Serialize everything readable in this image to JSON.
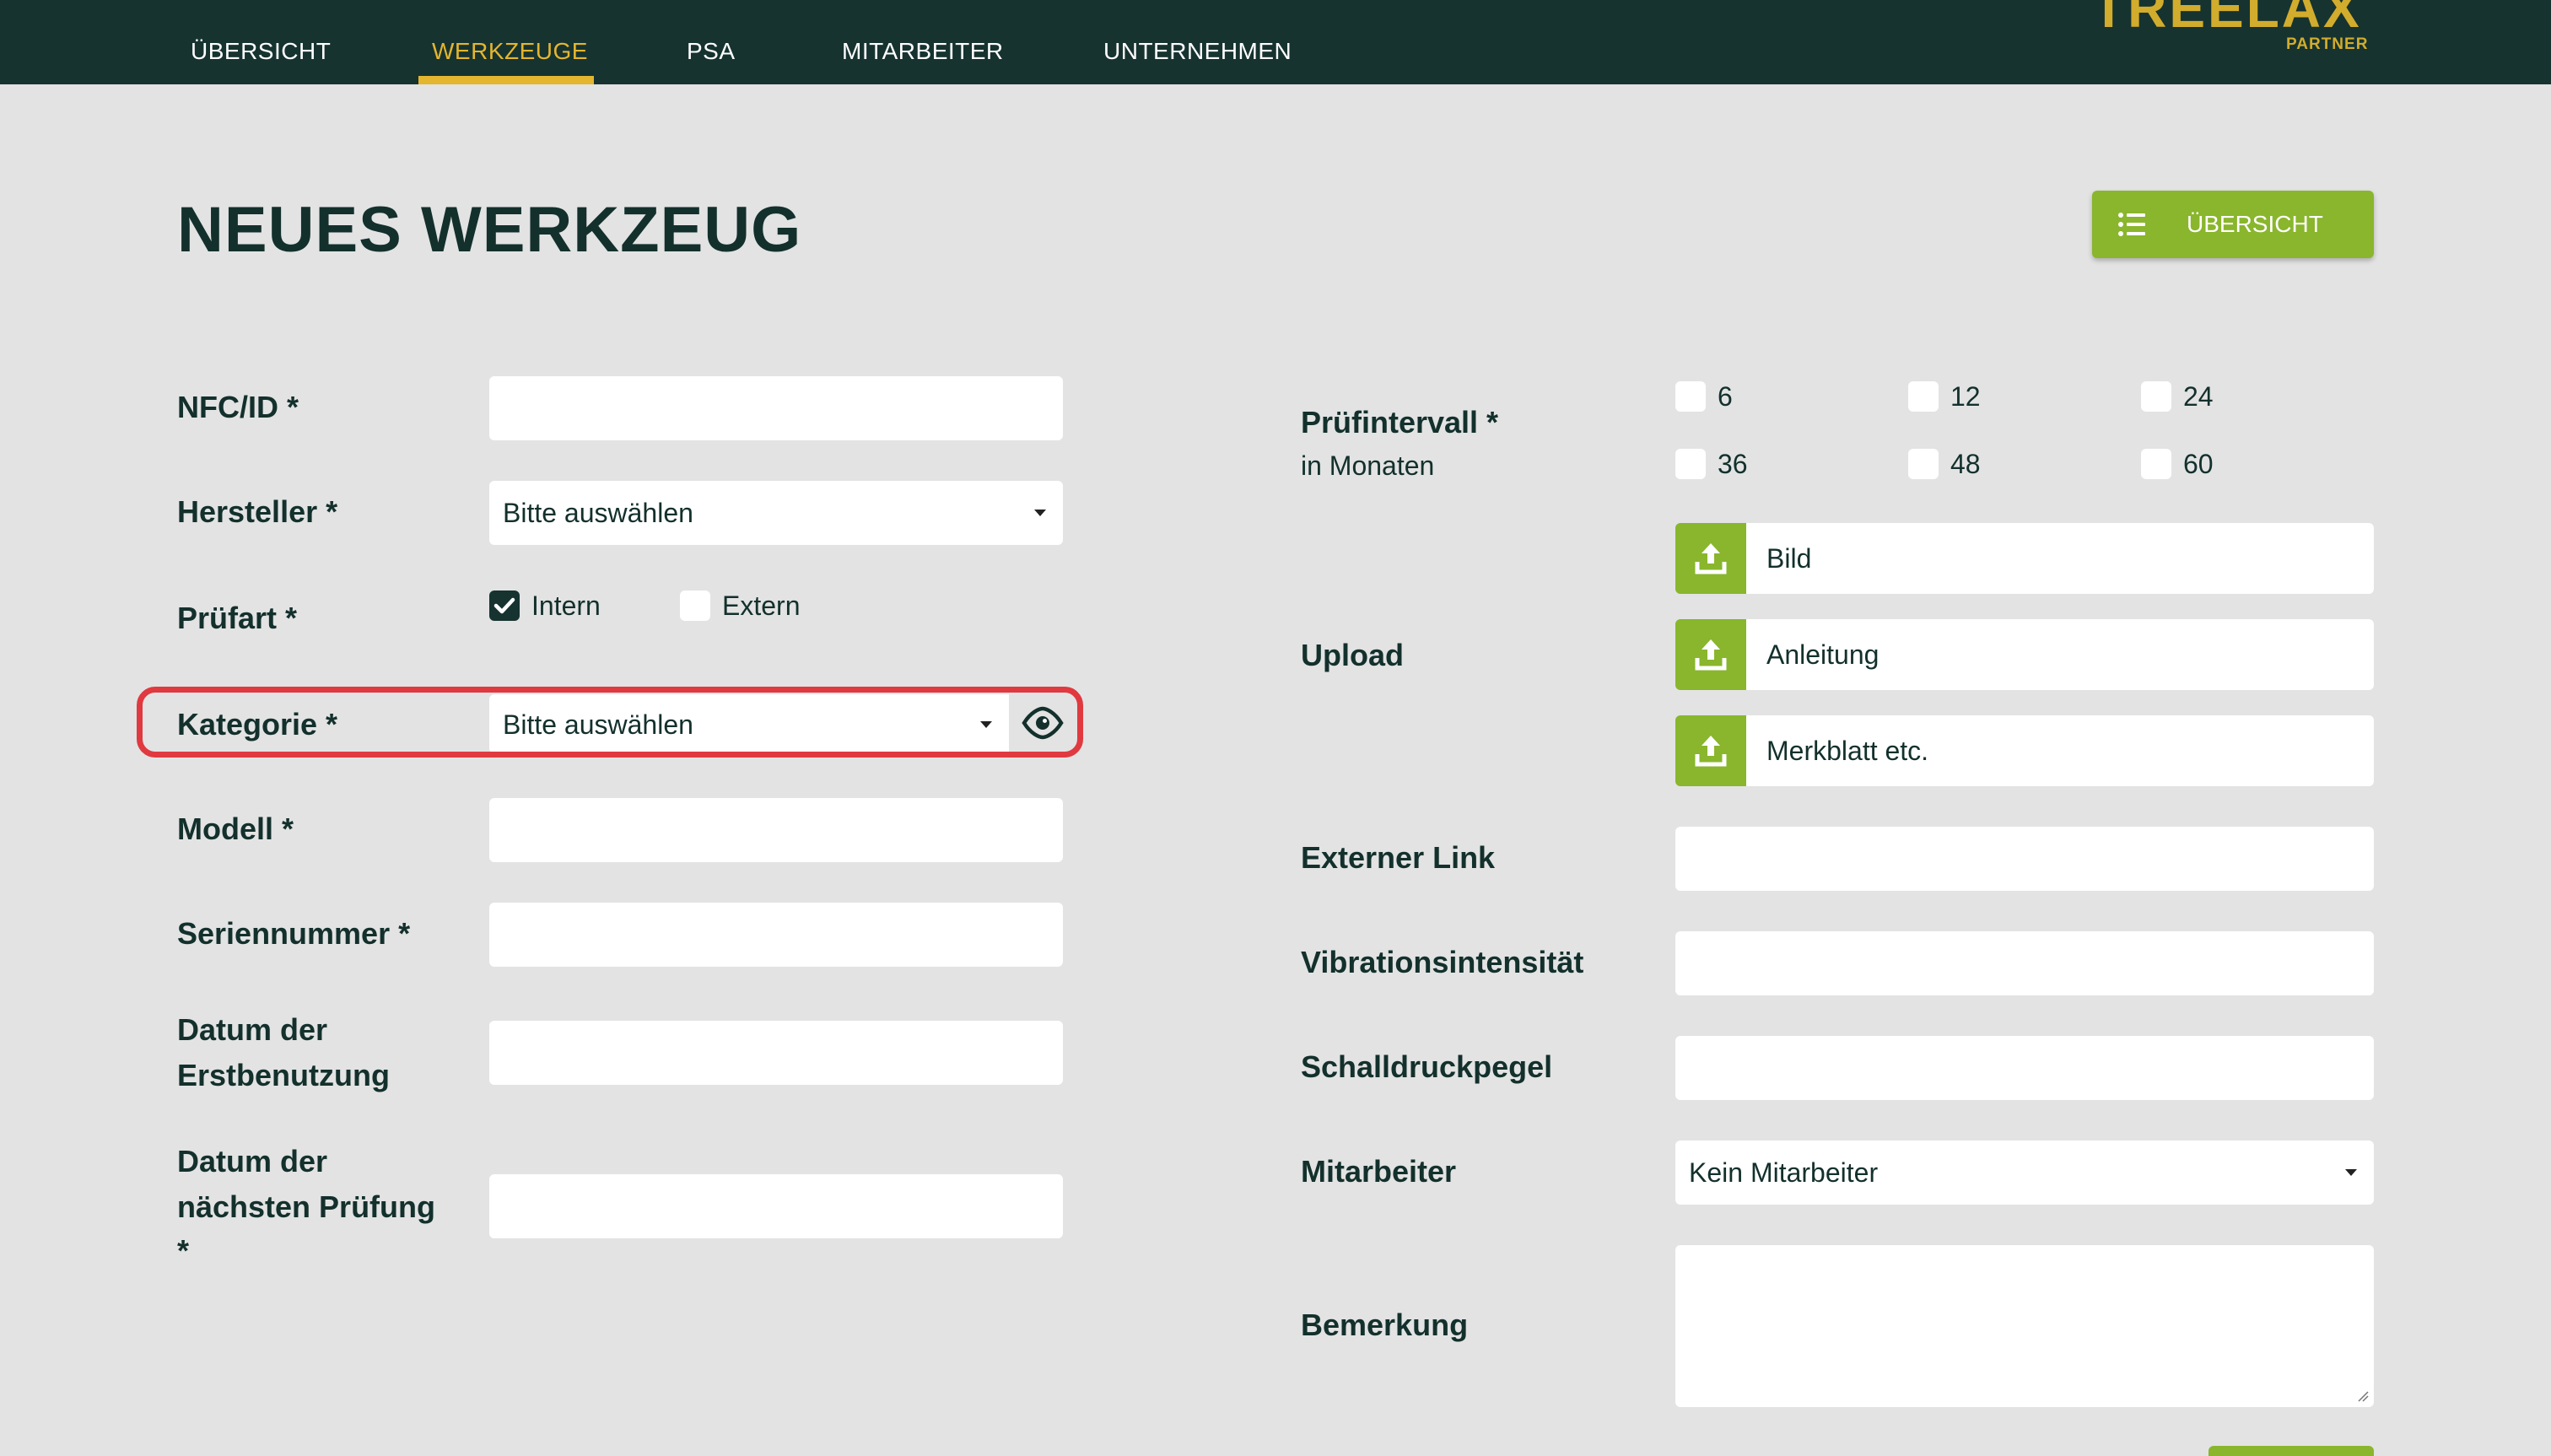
{
  "nav": {
    "items": [
      {
        "label": "ÜBERSICHT"
      },
      {
        "label": "WERKZEUGE"
      },
      {
        "label": "PSA"
      },
      {
        "label": "MITARBEITER"
      },
      {
        "label": "UNTERNEHMEN"
      }
    ],
    "active": "WERKZEUGE"
  },
  "logo": {
    "text": "TREELAX",
    "sub": "PARTNER"
  },
  "page": {
    "title": "NEUES WERKZEUG",
    "overview_button": "ÜBERSICHT"
  },
  "form_left": {
    "nfc_label": "NFC/ID *",
    "nfc_value": "",
    "hersteller_label": "Hersteller *",
    "hersteller_value": "Bitte auswählen",
    "pruefart_label": "Prüfart *",
    "pruefart_options": [
      {
        "label": "Intern",
        "checked": true
      },
      {
        "label": "Extern",
        "checked": false
      }
    ],
    "kategorie_label": "Kategorie *",
    "kategorie_value": "Bitte auswählen",
    "modell_label": "Modell *",
    "seriennummer_label": "Seriennummer *",
    "erstbenutzung_label_1": "Datum der",
    "erstbenutzung_label_2": "Erstbenutzung",
    "naechste_pruefung_label_1": "Datum der",
    "naechste_pruefung_label_2": "nächsten Prüfung",
    "naechste_pruefung_label_3": "*"
  },
  "form_right": {
    "pruefintervall_label": "Prüfintervall *",
    "pruefintervall_sub": "in Monaten",
    "intervals": [
      "6",
      "12",
      "24",
      "36",
      "48",
      "60"
    ],
    "upload_label": "Upload",
    "uploads": [
      "Bild",
      "Anleitung",
      "Merkblatt etc."
    ],
    "externer_link_label": "Externer Link",
    "vibration_label": "Vibrationsintensität",
    "schall_label": "Schalldruckpegel",
    "mitarbeiter_label": "Mitarbeiter",
    "mitarbeiter_value": "Kein Mitarbeiter",
    "bemerkung_label": "Bemerkung"
  },
  "colors": {
    "header_bg": "#163330",
    "accent_gold": "#e4b52f",
    "accent_green": "#89b62c",
    "highlight_red": "#e0393f",
    "page_bg": "#e3e3e3"
  },
  "icons": {
    "overview": "list-icon",
    "upload": "upload-icon",
    "kategorie_view": "eye-icon",
    "select_caret": "caret-down-icon",
    "checkbox_checked": "check-icon"
  }
}
